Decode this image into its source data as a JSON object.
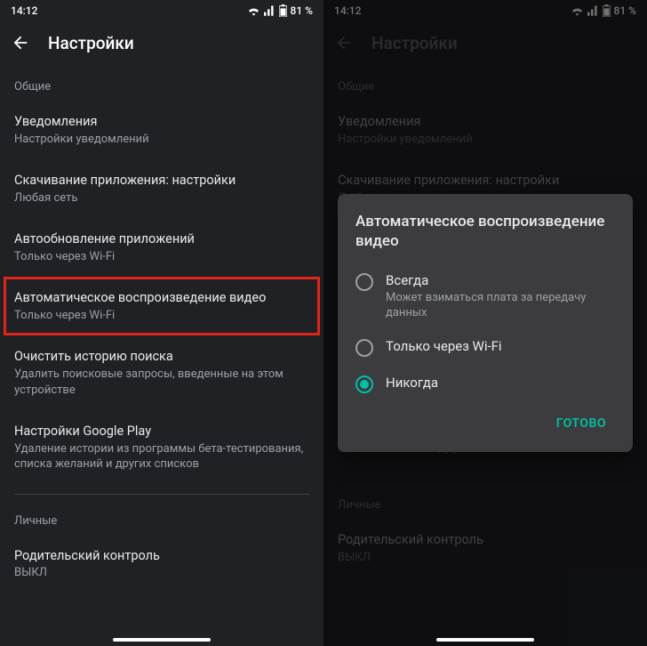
{
  "status": {
    "time": "14:12",
    "battery": "81 %"
  },
  "header": {
    "title": "Настройки"
  },
  "sections": {
    "general": "Общие",
    "personal": "Личные"
  },
  "items": {
    "notifications": {
      "title": "Уведомления",
      "sub": "Настройки уведомлений"
    },
    "download": {
      "title": "Скачивание приложения: настройки",
      "sub": "Любая сеть"
    },
    "autoupdate": {
      "title": "Автообновление приложений",
      "sub": "Только через Wi-Fi"
    },
    "autoplay": {
      "title": "Автоматическое воспроизведение видео",
      "sub": "Только через Wi-Fi"
    },
    "clearhistory": {
      "title": "Очистить историю поиска",
      "sub": "Удалить поисковые запросы, введенные на этом устройстве"
    },
    "playsettings": {
      "title": "Настройки Google Play",
      "sub": "Удаление истории из программы бета-тестирования, списка желаний и других списков"
    },
    "parental": {
      "title": "Родительский контроль",
      "sub": "ВЫКЛ"
    }
  },
  "dialog": {
    "title": "Автоматическое воспроизведение видео",
    "options": {
      "always": {
        "label": "Всегда",
        "sub": "Может взиматься плата за передачу данных"
      },
      "wifi": {
        "label": "Только через Wi-Fi"
      },
      "never": {
        "label": "Никогда"
      }
    },
    "action": "ГОТОВО"
  },
  "colors": {
    "accent": "#00bfa5",
    "highlight": "#e2231a"
  }
}
